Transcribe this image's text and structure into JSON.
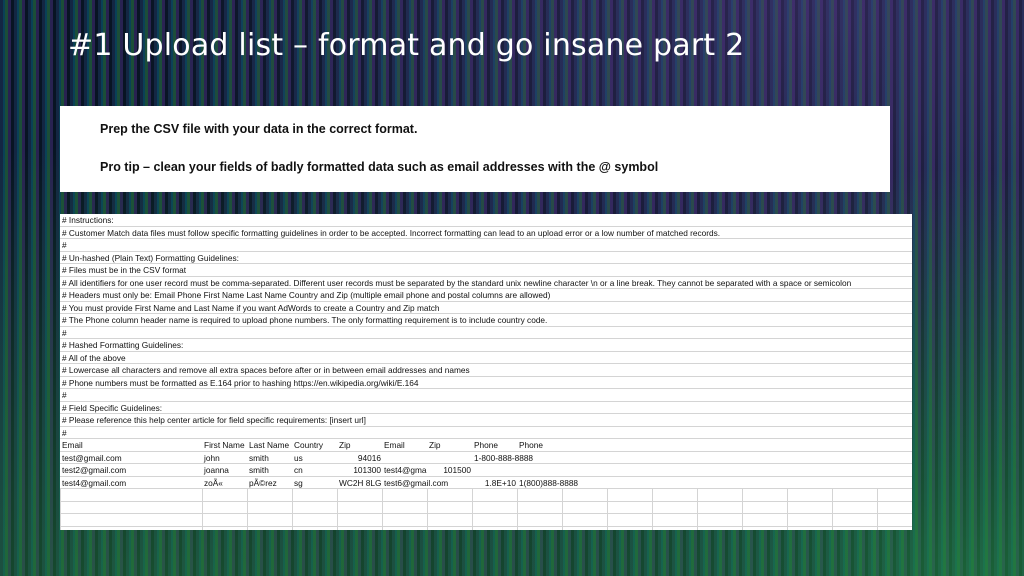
{
  "slide": {
    "title": "#1 Upload list – format and go insane part 2"
  },
  "tips": {
    "line1": "Prep the CSV file with your data in the correct format.",
    "line2": "Pro tip – clean your fields of badly formatted data such as email addresses with  the @ symbol"
  },
  "sheet": {
    "instructions": [
      "# Instructions:",
      "# Customer Match data files must follow specific formatting guidelines in order to be accepted. Incorrect formatting can lead to an upload error or a low number of matched records.",
      "#",
      "# Un-hashed (Plain Text) Formatting Guidelines:",
      "# Files must be in the CSV format",
      "# All identifiers for one user record must be comma-separated. Different user records must be separated by the standard unix newline character \\n or a line break. They cannot be separated with a space or semicolon",
      "# Headers must only be: Email Phone First Name Last Name Country and Zip (multiple email phone and postal columns are allowed)",
      "# You must provide First Name and Last Name if you want AdWords to create a Country and Zip match",
      "# The Phone column header name is required to upload phone numbers.  The only formatting requirement is to include country code.",
      "#",
      "# Hashed Formatting Guidelines:",
      "# All of the above",
      "# Lowercase all characters and remove all extra spaces before after or in between email addresses and names",
      "# Phone numbers must be formatted as E.164 prior to hashing https://en.wikipedia.org/wiki/E.164",
      "#",
      "# Field Specific Guidelines:",
      "# Please reference this help center article for field specific requirements: [insert url]",
      "#"
    ],
    "headers": [
      "Email",
      "First Name",
      "Last Name",
      "Country",
      "Zip",
      "Email",
      "Zip",
      "Phone",
      "Phone"
    ],
    "rows": [
      [
        "test@gmail.com",
        "john",
        "smith",
        "us",
        "94016",
        "",
        "",
        "1-800-888-8888",
        ""
      ],
      [
        "test2@gmail.com",
        "joanna",
        "smith",
        "cn",
        "101300",
        "test4@gma",
        "101500",
        "",
        ""
      ],
      [
        "test4@gmail.com",
        "zoÃ«",
        "pÃ©rez",
        "sg",
        "WC2H 8LG",
        "test6@gmail.com",
        "",
        "1.8E+10",
        "1(800)888-8888"
      ]
    ]
  }
}
